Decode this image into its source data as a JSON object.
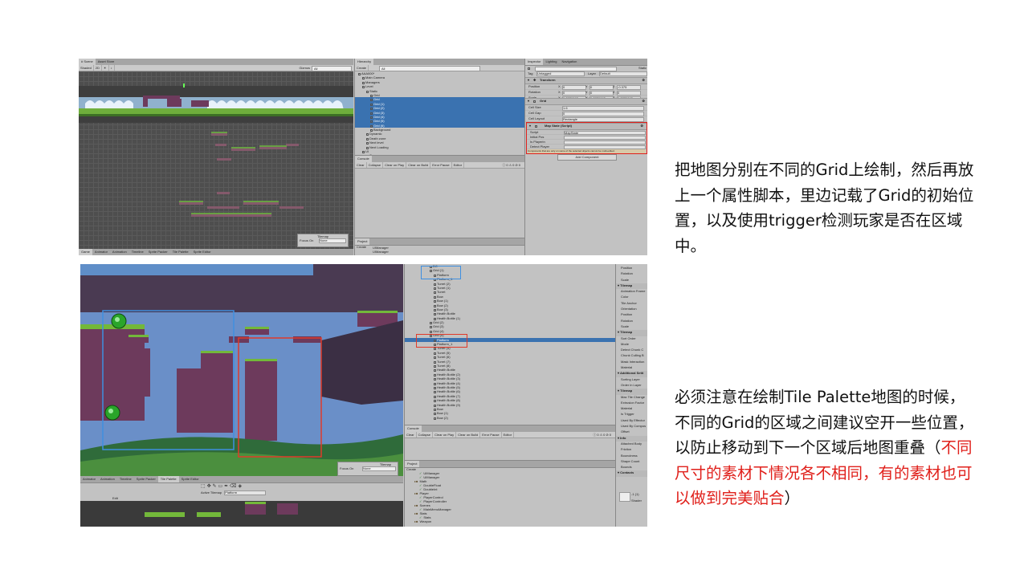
{
  "screenshot1": {
    "scene": {
      "tabs": [
        "# Scene",
        "Asset Store"
      ],
      "shading": "Shaded",
      "gizmos_label": "Gizmos",
      "search_placeholder": "All",
      "bottom_tabs": [
        "Game",
        "Animator",
        "Animation",
        "Timeline",
        "Sprite Packer",
        "Tile Palette",
        "Sprite Editor"
      ],
      "tilemap_overlay": {
        "title": "Tilemap",
        "focus_label": "Focus On",
        "focus_value": "None"
      }
    },
    "hierarchy": {
      "tab": "Hierarchy",
      "create_label": "Create",
      "search_placeholder": "All",
      "items": [
        {
          "label": "AAA000*",
          "indent": 0,
          "selected": false
        },
        {
          "label": "Main Camera",
          "indent": 1,
          "selected": false
        },
        {
          "label": "Managers",
          "indent": 1,
          "selected": false
        },
        {
          "label": "Level",
          "indent": 1,
          "selected": false
        },
        {
          "label": "Static",
          "indent": 2,
          "selected": false
        },
        {
          "label": "Grid",
          "indent": 3,
          "selected": false
        },
        {
          "label": "Grid",
          "indent": 3,
          "selected": true
        },
        {
          "label": "Grid (1)",
          "indent": 3,
          "selected": true
        },
        {
          "label": "Grid (2)",
          "indent": 3,
          "selected": true
        },
        {
          "label": "Grid (3)",
          "indent": 3,
          "selected": true
        },
        {
          "label": "Grid (4)",
          "indent": 3,
          "selected": true
        },
        {
          "label": "Grid (5)",
          "indent": 3,
          "selected": true
        },
        {
          "label": "Grid (6)",
          "indent": 3,
          "selected": true
        },
        {
          "label": "Background",
          "indent": 3,
          "selected": false
        },
        {
          "label": "Dynamic",
          "indent": 2,
          "selected": false
        },
        {
          "label": "Death zone",
          "indent": 2,
          "selected": false
        },
        {
          "label": "Next level",
          "indent": 2,
          "selected": false
        },
        {
          "label": "Next Loading",
          "indent": 2,
          "selected": false
        },
        {
          "label": "UI",
          "indent": 1,
          "selected": false
        },
        {
          "label": "Canvas",
          "indent": 2,
          "selected": false
        },
        {
          "label": "GameScreen",
          "indent": 2,
          "selected": false
        },
        {
          "label": "EventSystem",
          "indent": 2,
          "selected": false
        }
      ]
    },
    "console": {
      "tab": "Console",
      "buttons": [
        "Clear",
        "Collapse",
        "Clear on Play",
        "Clear on Build",
        "Error Pause",
        "Editor"
      ],
      "counts": [
        "0",
        "0",
        "0"
      ]
    },
    "project": {
      "tab": "Project",
      "create_label": "Create",
      "items": [
        "UIManager",
        "UIManager"
      ]
    },
    "inspector": {
      "tabs": [
        "Inspector",
        "Lighting",
        "Navigation"
      ],
      "static_label": "Static",
      "tag_label": "Tag",
      "tag_value": "Untagged",
      "layer_label": "Layer",
      "layer_value": "Default",
      "transform": {
        "title": "Transform",
        "rows": [
          {
            "label": "Position",
            "x": "0",
            "y": "0",
            "z": "-0.375"
          },
          {
            "label": "Rotation",
            "x": "0",
            "y": "0",
            "z": "0"
          },
          {
            "label": "Scale",
            "x": "0.3770093",
            "y": "0.3770093",
            "z": "0.3770093"
          }
        ]
      },
      "grid": {
        "title": "Grid",
        "rows": [
          {
            "label": "Cell Size",
            "value": "1.6"
          },
          {
            "label": "Cell Gap",
            "value": "0"
          },
          {
            "label": "Cell Layout",
            "value": "Rectangle"
          },
          {
            "label": "Cell Swizzle",
            "value": "XYZ"
          }
        ]
      },
      "map_state": {
        "title": "Map State (Script)",
        "rows": [
          {
            "label": "Script",
            "value": "MapState"
          },
          {
            "label": "Initial Pos",
            "value": ""
          },
          {
            "label": "Is Playerin",
            "value": ""
          },
          {
            "label": "Detect Player",
            "value": ""
          }
        ],
        "warning": "Components that are only on some of the selected objects cannot be multi-edited."
      },
      "add_component": "Add Component"
    }
  },
  "screenshot2": {
    "hierarchy_items": [
      {
        "label": "DC",
        "indent": 1,
        "selected": false
      },
      {
        "label": "Grid (1)",
        "indent": 1,
        "selected": false
      },
      {
        "label": "Platform",
        "indent": 2,
        "selected": false
      },
      {
        "label": "Platform_1",
        "indent": 2,
        "selected": false
      },
      {
        "label": "Turret (2)",
        "indent": 2,
        "selected": false
      },
      {
        "label": "Turret (1)",
        "indent": 2,
        "selected": false
      },
      {
        "label": "Turret",
        "indent": 2,
        "selected": false
      },
      {
        "label": "Bow",
        "indent": 2,
        "selected": false
      },
      {
        "label": "Bow (1)",
        "indent": 2,
        "selected": false
      },
      {
        "label": "Bow (2)",
        "indent": 2,
        "selected": false
      },
      {
        "label": "Bow (3)",
        "indent": 2,
        "selected": false
      },
      {
        "label": "Health Bottle",
        "indent": 2,
        "selected": false
      },
      {
        "label": "Health Bottle (1)",
        "indent": 2,
        "selected": false
      },
      {
        "label": "Grid (2)",
        "indent": 1,
        "selected": false
      },
      {
        "label": "Grid (3)",
        "indent": 1,
        "selected": false
      },
      {
        "label": "Grid (4)",
        "indent": 1,
        "selected": false
      },
      {
        "label": "Grid (5)",
        "indent": 1,
        "selected": false
      },
      {
        "label": "Platform",
        "indent": 2,
        "selected": true
      },
      {
        "label": "Platform_1",
        "indent": 2,
        "selected": false
      },
      {
        "label": "Turret (4)",
        "indent": 2,
        "selected": false
      },
      {
        "label": "Turret (5)",
        "indent": 2,
        "selected": false
      },
      {
        "label": "Turret (6)",
        "indent": 2,
        "selected": false
      },
      {
        "label": "Turret (7)",
        "indent": 2,
        "selected": false
      },
      {
        "label": "Turret (8)",
        "indent": 2,
        "selected": false
      },
      {
        "label": "Health Bottle",
        "indent": 2,
        "selected": false
      },
      {
        "label": "Health Bottle (2)",
        "indent": 2,
        "selected": false
      },
      {
        "label": "Health Bottle (3)",
        "indent": 2,
        "selected": false
      },
      {
        "label": "Health Bottle (4)",
        "indent": 2,
        "selected": false
      },
      {
        "label": "Health Bottle (5)",
        "indent": 2,
        "selected": false
      },
      {
        "label": "Health Bottle (6)",
        "indent": 2,
        "selected": false
      },
      {
        "label": "Health Bottle (7)",
        "indent": 2,
        "selected": false
      },
      {
        "label": "Health Bottle (8)",
        "indent": 2,
        "selected": false
      },
      {
        "label": "Health Bottle (9)",
        "indent": 2,
        "selected": false
      },
      {
        "label": "Bow",
        "indent": 2,
        "selected": false
      },
      {
        "label": "Bow (1)",
        "indent": 2,
        "selected": false
      },
      {
        "label": "Bow (2)",
        "indent": 2,
        "selected": false
      }
    ],
    "console": {
      "tab": "Console",
      "buttons": [
        "Clear",
        "Collapse",
        "Clear on Play",
        "Clear on Build",
        "Error Pause",
        "Editor"
      ],
      "counts": [
        "0",
        "0",
        "0"
      ]
    },
    "project": {
      "tab": "Project",
      "create_label": "Create",
      "items": [
        {
          "label": "UIManager",
          "indent": 2,
          "folder": false
        },
        {
          "label": "UIManager",
          "indent": 2,
          "folder": false
        },
        {
          "label": "Math",
          "indent": 1,
          "folder": true
        },
        {
          "label": "DoubleFloat",
          "indent": 2,
          "folder": false
        },
        {
          "label": "DoubleInt",
          "indent": 2,
          "folder": false
        },
        {
          "label": "Player",
          "indent": 1,
          "folder": true
        },
        {
          "label": "PlayerControl",
          "indent": 2,
          "folder": false
        },
        {
          "label": "PlayerController",
          "indent": 2,
          "folder": false
        },
        {
          "label": "Scenes",
          "indent": 1,
          "folder": true
        },
        {
          "label": "MainMenuManager",
          "indent": 2,
          "folder": false
        },
        {
          "label": "Stats",
          "indent": 1,
          "folder": true
        },
        {
          "label": "Stats",
          "indent": 2,
          "folder": false
        },
        {
          "label": "Weapon",
          "indent": 1,
          "folder": true
        }
      ]
    },
    "inspector_items": [
      {
        "label": "Position",
        "header": false
      },
      {
        "label": "Rotation",
        "header": false
      },
      {
        "label": "Scale",
        "header": false
      },
      {
        "label": "Tilemap",
        "header": true
      },
      {
        "label": "Animation Frame",
        "header": false
      },
      {
        "label": "Color",
        "header": false
      },
      {
        "label": "Tile Anchor",
        "header": false
      },
      {
        "label": "Orientation",
        "header": false
      },
      {
        "label": "Position",
        "header": false
      },
      {
        "label": "Rotation",
        "header": false
      },
      {
        "label": "Scale",
        "header": false
      },
      {
        "label": "Tilemap",
        "header": true
      },
      {
        "label": "Sort Order",
        "header": false
      },
      {
        "label": "Mode",
        "header": false
      },
      {
        "label": "Detect Chunk C",
        "header": false
      },
      {
        "label": "Chunk Culling B",
        "header": false
      },
      {
        "label": "Mask Interaction",
        "header": false
      },
      {
        "label": "Material",
        "header": false
      },
      {
        "label": "Additional Setti",
        "header": true
      },
      {
        "label": "Sorting Layer",
        "header": false
      },
      {
        "label": "Order in Layer",
        "header": false
      },
      {
        "label": "Tilemap",
        "header": true
      },
      {
        "label": "Max Tile Change",
        "header": false
      },
      {
        "label": "Extrusion Factor",
        "header": false
      },
      {
        "label": "Material",
        "header": false
      },
      {
        "label": "Is Trigger",
        "header": false
      },
      {
        "label": "Used By Effector",
        "header": false
      },
      {
        "label": "Used By Compos",
        "header": false
      },
      {
        "label": "Offset",
        "header": false
      },
      {
        "label": "Info",
        "header": true
      },
      {
        "label": "Attached Body",
        "header": false
      },
      {
        "label": "Friction",
        "header": false
      },
      {
        "label": "Bounciness",
        "header": false
      },
      {
        "label": "Shape Count",
        "header": false
      },
      {
        "label": "Bounds",
        "header": false
      },
      {
        "label": "Contacts",
        "header": true
      }
    ],
    "inspector_footer": {
      "count": "-1 (1)",
      "shader_label": "Shader"
    },
    "tilemap_overlay": {
      "title": "Tilemap",
      "focus_label": "Focus On",
      "focus_value": "None"
    },
    "bottom_tabs": [
      "Animator",
      "Animation",
      "Timeline",
      "Sprite Packer",
      "Tile Palette",
      "Sprite Editor"
    ],
    "palette": {
      "active_label": "Active Tilemap",
      "active_value": "Platform",
      "edit_label": "Edit"
    }
  },
  "captions": {
    "top": "把地图分别在不同的Grid上绘制，然后再放上一个属性脚本，里边记载了Grid的初始位置，以及使用trigger检测玩家是否在区域中。",
    "bottom_main": "必须注意在绘制Tile Palette地图的时候，不同的Grid的区域之间建议空开一些位置，以防止移动到下一个区域后地图重叠（",
    "bottom_red": "不同尺寸的素材下情况各不相同，有的素材也可以做到完美贴合",
    "bottom_end": "）"
  },
  "colors": {
    "highlight_red": "#e0201b",
    "selection_blue": "#3a72b0",
    "region_blue": "#3f8fe0",
    "region_red": "#e03a2a",
    "tile_purple": "#6d3a5c",
    "grass_green": "#73b83a"
  }
}
